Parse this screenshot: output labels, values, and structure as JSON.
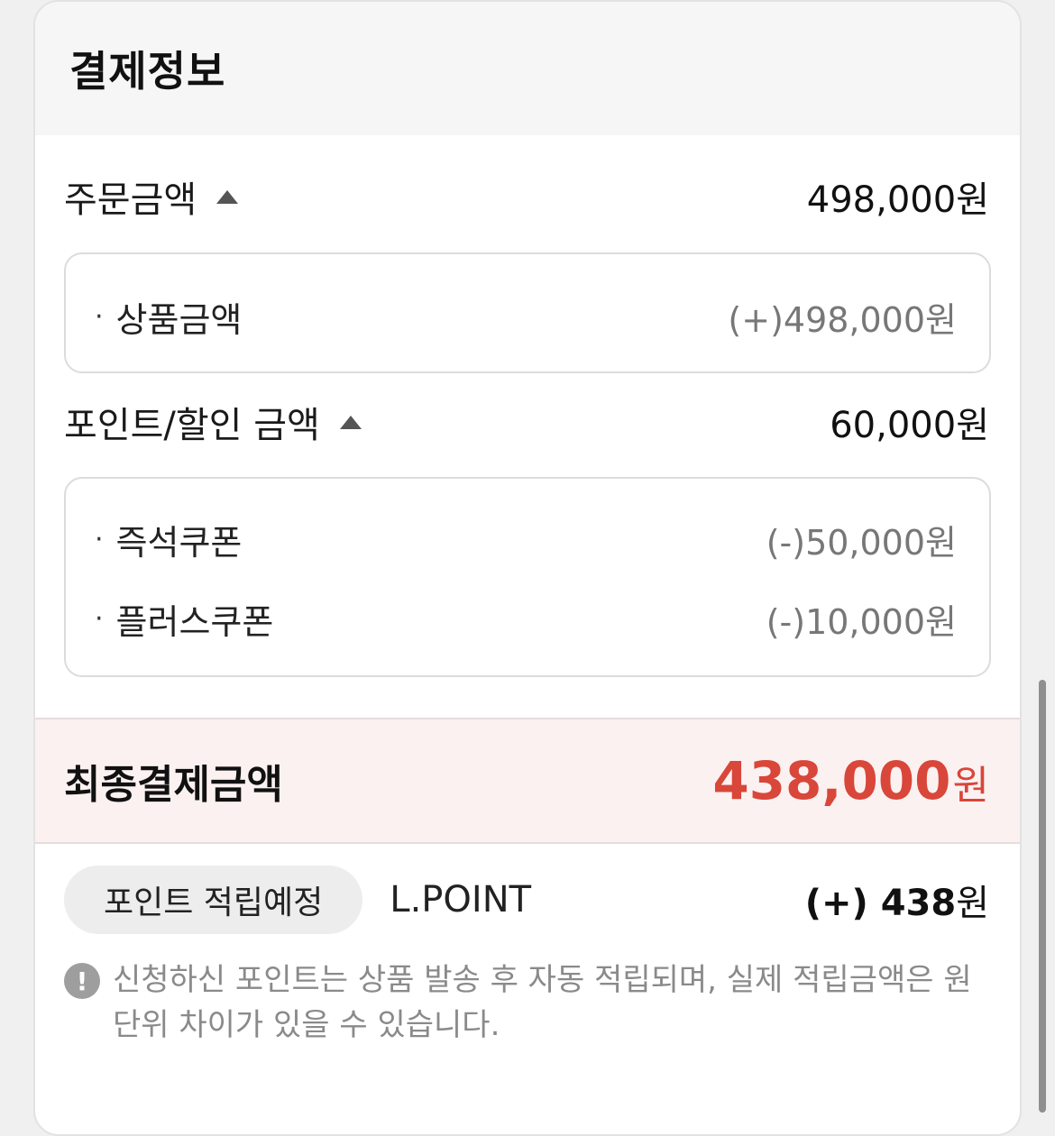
{
  "header": {
    "title": "결제정보"
  },
  "order_amount": {
    "label": "주문금액",
    "value": "498,000원",
    "details": [
      {
        "label": "상품금액",
        "value": "(+)498,000원"
      }
    ]
  },
  "discount": {
    "label": "포인트/할인 금액",
    "value": "60,000원",
    "details": [
      {
        "label": "즉석쿠폰",
        "value": "(-)50,000원"
      },
      {
        "label": "플러스쿠폰",
        "value": "(-)10,000원"
      }
    ]
  },
  "final": {
    "label": "최종결제금액",
    "amount": "438,000",
    "unit": "원",
    "color": "#d9463a"
  },
  "points": {
    "badge": "포인트 적립예정",
    "provider": "L.POINT",
    "value": "(+) 438",
    "unit": "원"
  },
  "notice": {
    "icon": "exclamation-icon",
    "icon_glyph": "!",
    "text": "신청하신 포인트는 상품 발송 후 자동 적립되며, 실제 적립금액은 원단위 차이가 있을 수 있습니다."
  },
  "bullet_glyph": "·"
}
